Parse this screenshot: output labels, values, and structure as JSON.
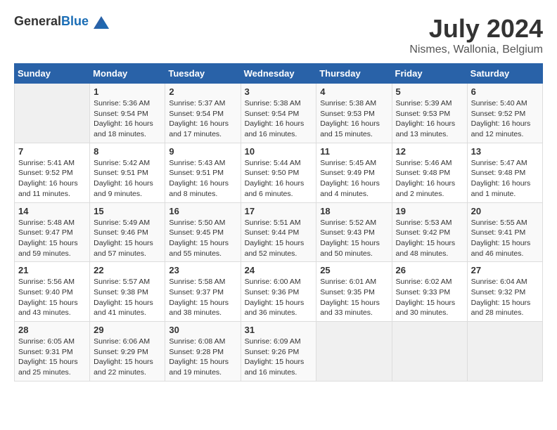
{
  "header": {
    "logo_general": "General",
    "logo_blue": "Blue",
    "title": "July 2024",
    "location": "Nismes, Wallonia, Belgium"
  },
  "calendar": {
    "days_of_week": [
      "Sunday",
      "Monday",
      "Tuesday",
      "Wednesday",
      "Thursday",
      "Friday",
      "Saturday"
    ],
    "weeks": [
      [
        {
          "day": "",
          "info": ""
        },
        {
          "day": "1",
          "info": "Sunrise: 5:36 AM\nSunset: 9:54 PM\nDaylight: 16 hours\nand 18 minutes."
        },
        {
          "day": "2",
          "info": "Sunrise: 5:37 AM\nSunset: 9:54 PM\nDaylight: 16 hours\nand 17 minutes."
        },
        {
          "day": "3",
          "info": "Sunrise: 5:38 AM\nSunset: 9:54 PM\nDaylight: 16 hours\nand 16 minutes."
        },
        {
          "day": "4",
          "info": "Sunrise: 5:38 AM\nSunset: 9:53 PM\nDaylight: 16 hours\nand 15 minutes."
        },
        {
          "day": "5",
          "info": "Sunrise: 5:39 AM\nSunset: 9:53 PM\nDaylight: 16 hours\nand 13 minutes."
        },
        {
          "day": "6",
          "info": "Sunrise: 5:40 AM\nSunset: 9:52 PM\nDaylight: 16 hours\nand 12 minutes."
        }
      ],
      [
        {
          "day": "7",
          "info": "Sunrise: 5:41 AM\nSunset: 9:52 PM\nDaylight: 16 hours\nand 11 minutes."
        },
        {
          "day": "8",
          "info": "Sunrise: 5:42 AM\nSunset: 9:51 PM\nDaylight: 16 hours\nand 9 minutes."
        },
        {
          "day": "9",
          "info": "Sunrise: 5:43 AM\nSunset: 9:51 PM\nDaylight: 16 hours\nand 8 minutes."
        },
        {
          "day": "10",
          "info": "Sunrise: 5:44 AM\nSunset: 9:50 PM\nDaylight: 16 hours\nand 6 minutes."
        },
        {
          "day": "11",
          "info": "Sunrise: 5:45 AM\nSunset: 9:49 PM\nDaylight: 16 hours\nand 4 minutes."
        },
        {
          "day": "12",
          "info": "Sunrise: 5:46 AM\nSunset: 9:48 PM\nDaylight: 16 hours\nand 2 minutes."
        },
        {
          "day": "13",
          "info": "Sunrise: 5:47 AM\nSunset: 9:48 PM\nDaylight: 16 hours\nand 1 minute."
        }
      ],
      [
        {
          "day": "14",
          "info": "Sunrise: 5:48 AM\nSunset: 9:47 PM\nDaylight: 15 hours\nand 59 minutes."
        },
        {
          "day": "15",
          "info": "Sunrise: 5:49 AM\nSunset: 9:46 PM\nDaylight: 15 hours\nand 57 minutes."
        },
        {
          "day": "16",
          "info": "Sunrise: 5:50 AM\nSunset: 9:45 PM\nDaylight: 15 hours\nand 55 minutes."
        },
        {
          "day": "17",
          "info": "Sunrise: 5:51 AM\nSunset: 9:44 PM\nDaylight: 15 hours\nand 52 minutes."
        },
        {
          "day": "18",
          "info": "Sunrise: 5:52 AM\nSunset: 9:43 PM\nDaylight: 15 hours\nand 50 minutes."
        },
        {
          "day": "19",
          "info": "Sunrise: 5:53 AM\nSunset: 9:42 PM\nDaylight: 15 hours\nand 48 minutes."
        },
        {
          "day": "20",
          "info": "Sunrise: 5:55 AM\nSunset: 9:41 PM\nDaylight: 15 hours\nand 46 minutes."
        }
      ],
      [
        {
          "day": "21",
          "info": "Sunrise: 5:56 AM\nSunset: 9:40 PM\nDaylight: 15 hours\nand 43 minutes."
        },
        {
          "day": "22",
          "info": "Sunrise: 5:57 AM\nSunset: 9:38 PM\nDaylight: 15 hours\nand 41 minutes."
        },
        {
          "day": "23",
          "info": "Sunrise: 5:58 AM\nSunset: 9:37 PM\nDaylight: 15 hours\nand 38 minutes."
        },
        {
          "day": "24",
          "info": "Sunrise: 6:00 AM\nSunset: 9:36 PM\nDaylight: 15 hours\nand 36 minutes."
        },
        {
          "day": "25",
          "info": "Sunrise: 6:01 AM\nSunset: 9:35 PM\nDaylight: 15 hours\nand 33 minutes."
        },
        {
          "day": "26",
          "info": "Sunrise: 6:02 AM\nSunset: 9:33 PM\nDaylight: 15 hours\nand 30 minutes."
        },
        {
          "day": "27",
          "info": "Sunrise: 6:04 AM\nSunset: 9:32 PM\nDaylight: 15 hours\nand 28 minutes."
        }
      ],
      [
        {
          "day": "28",
          "info": "Sunrise: 6:05 AM\nSunset: 9:31 PM\nDaylight: 15 hours\nand 25 minutes."
        },
        {
          "day": "29",
          "info": "Sunrise: 6:06 AM\nSunset: 9:29 PM\nDaylight: 15 hours\nand 22 minutes."
        },
        {
          "day": "30",
          "info": "Sunrise: 6:08 AM\nSunset: 9:28 PM\nDaylight: 15 hours\nand 19 minutes."
        },
        {
          "day": "31",
          "info": "Sunrise: 6:09 AM\nSunset: 9:26 PM\nDaylight: 15 hours\nand 16 minutes."
        },
        {
          "day": "",
          "info": ""
        },
        {
          "day": "",
          "info": ""
        },
        {
          "day": "",
          "info": ""
        }
      ]
    ]
  }
}
